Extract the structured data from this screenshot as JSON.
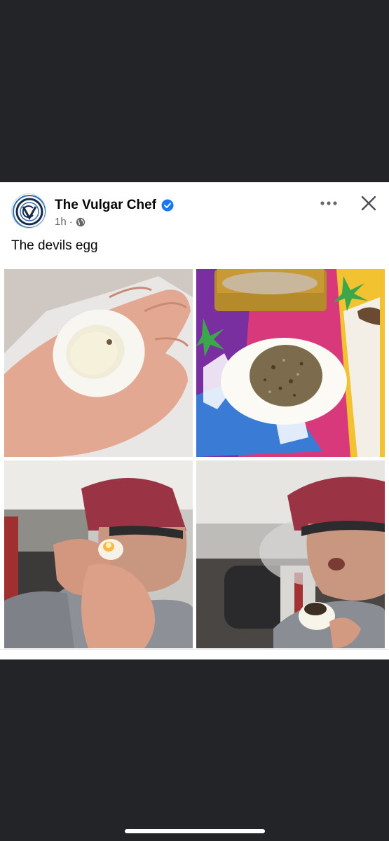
{
  "post": {
    "author": "The Vulgar Chef",
    "timestamp": "1h",
    "separator": "·",
    "caption": "The devils egg",
    "avatar_icon": "vulgar-chef-logo",
    "verified_icon": "verified-badge-icon",
    "privacy_icon": "globe-icon",
    "more_icon": "more-options-icon",
    "close_icon": "close-icon"
  },
  "photos": [
    {
      "subject": "hollowed-egg-in-hand"
    },
    {
      "subject": "egg-filled-with-herb"
    },
    {
      "subject": "man-lighting-egg-pipe"
    },
    {
      "subject": "man-exhaling-smoke"
    }
  ],
  "colors": {
    "background": "#232427",
    "card": "#ffffff",
    "verified": "#1877f2",
    "secondary_text": "#65676b"
  }
}
